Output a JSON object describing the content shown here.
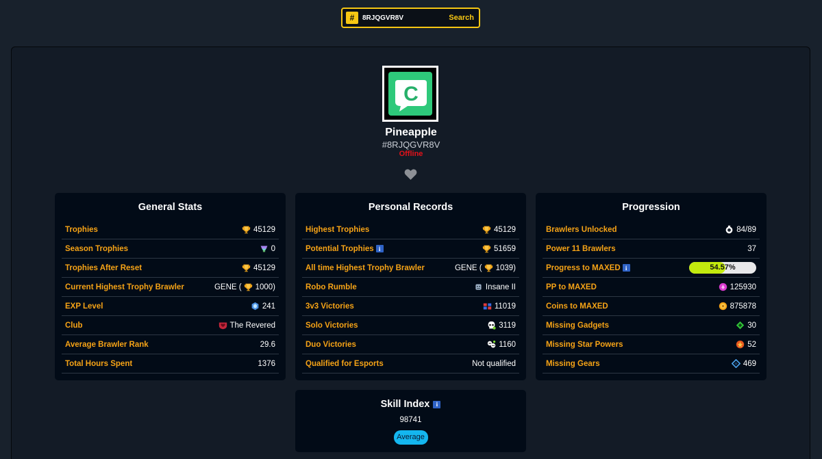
{
  "search": {
    "hash": "#",
    "value": "8RJQGVR8V",
    "button": "Search"
  },
  "profile": {
    "icon_letter": "C",
    "name": "Pineapple",
    "tag": "#8RJQGVR8V",
    "status": "Offline"
  },
  "general_stats": {
    "title": "General Stats",
    "rows": [
      {
        "label": "Trophies",
        "value": "45129",
        "icon": "trophy-icon"
      },
      {
        "label": "Season Trophies",
        "value": "0",
        "icon": "season-trophy-icon"
      },
      {
        "label": "Trophies After Reset",
        "value": "45129",
        "icon": "trophy-icon"
      },
      {
        "label": "Current Highest Trophy Brawler",
        "value_prefix": "GENE (",
        "value": "1000)",
        "icon": "trophy-icon"
      },
      {
        "label": "EXP Level",
        "value": "241",
        "icon": "exp-star-icon"
      },
      {
        "label": "Club",
        "value": "The Revered",
        "icon": "club-badge-icon"
      },
      {
        "label": "Average Brawler Rank",
        "value": "29.6"
      },
      {
        "label": "Total Hours Spent",
        "value": "1376"
      }
    ]
  },
  "personal_records": {
    "title": "Personal Records",
    "rows": [
      {
        "label": "Highest Trophies",
        "value": "45129",
        "icon": "trophy-icon"
      },
      {
        "label": "Potential Trophies",
        "value": "51659",
        "icon": "trophy-icon",
        "info": "i"
      },
      {
        "label": "All time Highest Trophy Brawler",
        "value_prefix": "GENE (",
        "value": "1039)",
        "icon": "trophy-icon"
      },
      {
        "label": "Robo Rumble",
        "value": "Insane II",
        "icon": "robo-icon"
      },
      {
        "label": "3v3 Victories",
        "value": "11019",
        "icon": "3v3-icon"
      },
      {
        "label": "Solo Victories",
        "value": "3119",
        "icon": "skull-icon"
      },
      {
        "label": "Duo Victories",
        "value": "1160",
        "icon": "duo-skull-icon"
      },
      {
        "label": "Qualified for Esports",
        "value": "Not qualified"
      }
    ]
  },
  "progression": {
    "title": "Progression",
    "rows": [
      {
        "label": "Brawlers Unlocked",
        "value": "84/89",
        "icon": "brawler-icon"
      },
      {
        "label": "Power 11 Brawlers",
        "value": "37"
      },
      {
        "label": "Progress to MAXED",
        "info": "i",
        "progress_text": "54.57%",
        "progress": 0.5457
      },
      {
        "label": "PP to MAXED",
        "value": "125930",
        "icon": "power-point-icon"
      },
      {
        "label": "Coins to MAXED",
        "value": "875878",
        "icon": "coin-icon"
      },
      {
        "label": "Missing Gadgets",
        "value": "30",
        "icon": "gadget-icon"
      },
      {
        "label": "Missing Star Powers",
        "value": "52",
        "icon": "star-power-icon"
      },
      {
        "label": "Missing Gears",
        "value": "469",
        "icon": "gear-icon"
      }
    ]
  },
  "skill_index": {
    "title": "Skill Index",
    "info": "i",
    "value": "98741",
    "badge": "Average"
  },
  "colors": {
    "accent": "#f7c713",
    "label": "#f6a316",
    "offline": "#e4121a",
    "card": "#020b17",
    "progress": "#c3ea0e",
    "badge": "#14b6ef"
  }
}
